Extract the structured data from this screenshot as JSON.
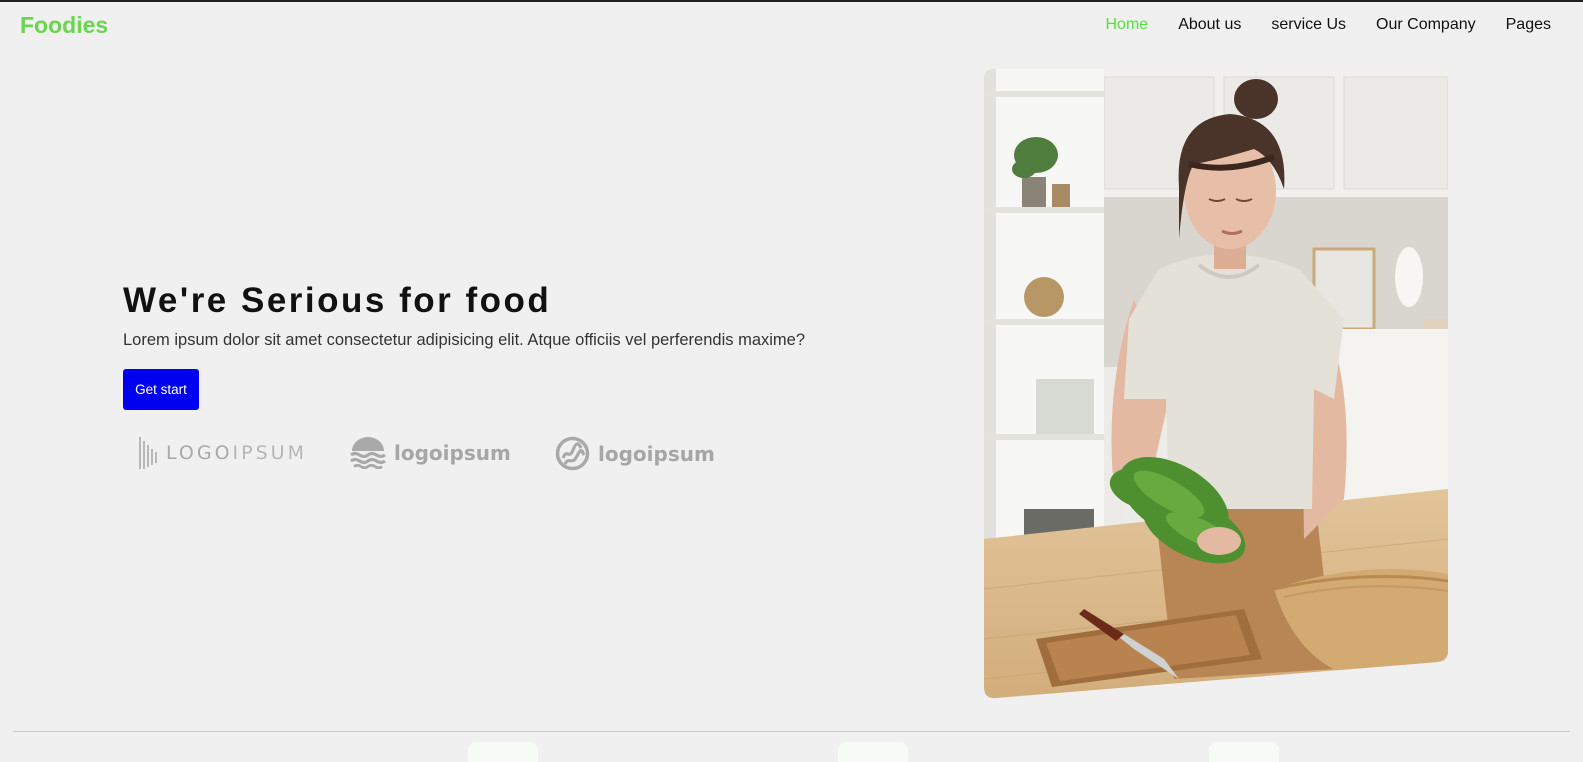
{
  "header": {
    "brand": "Foodies",
    "nav": [
      "Home",
      "About us",
      "service Us",
      "Our Company",
      "Pages"
    ],
    "active_index": 0
  },
  "hero": {
    "title": "We're Serious for food",
    "subtitle": "Lorem ipsum dolor sit amet consectetur adipisicing elit. Atque officiis vel perferendis maxime?",
    "cta_label": "Get start"
  },
  "partner_logos": [
    {
      "icon": "soundwave-logo-icon",
      "text_a": "LOGO",
      "text_b": "IPSUM"
    },
    {
      "icon": "waves-logo-icon",
      "text": "logoipsum"
    },
    {
      "icon": "circle-wave-logo-icon",
      "text": "logoipsum"
    }
  ],
  "colors": {
    "brand": "#6ad54f",
    "nav_active": "#52e33a",
    "cta_bg": "#0000f0",
    "page_bg": "#f0f0f0"
  },
  "hero_image": {
    "icon": "woman-preparing-salad-photo"
  }
}
